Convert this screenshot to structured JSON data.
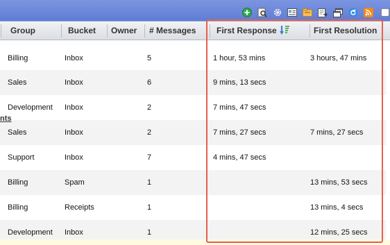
{
  "toolbar": {
    "icons": [
      "add-icon",
      "search-icon",
      "gear-icon",
      "card-icon",
      "folder-icon",
      "export-icon",
      "windows-icon",
      "refresh-icon",
      "rss-icon",
      "checkbox-icon"
    ],
    "accent": "#5f7dd6"
  },
  "header": {
    "group": "Group",
    "bucket": "Bucket",
    "owner": "Owner",
    "messages": "# Messages",
    "first_response": "First Response",
    "first_resolution": "First Resolution"
  },
  "section_label": "nts",
  "rows": [
    {
      "group": "Billing",
      "bucket": "Inbox",
      "owner": "",
      "messages": "5",
      "first_response": "1 hour, 53 mins",
      "first_resolution": "3 hours, 47 mins"
    },
    {
      "group": "Sales",
      "bucket": "Inbox",
      "owner": "",
      "messages": "6",
      "first_response": "9 mins, 13 secs",
      "first_resolution": ""
    },
    {
      "group": "Development",
      "bucket": "Inbox",
      "owner": "",
      "messages": "2",
      "first_response": "7 mins, 47 secs",
      "first_resolution": ""
    },
    {
      "group": "Sales",
      "bucket": "Inbox",
      "owner": "",
      "messages": "2",
      "first_response": "7 mins, 27 secs",
      "first_resolution": "7 mins, 27 secs"
    },
    {
      "group": "Support",
      "bucket": "Inbox",
      "owner": "",
      "messages": "7",
      "first_response": "4 mins, 47 secs",
      "first_resolution": ""
    },
    {
      "group": "Billing",
      "bucket": "Spam",
      "owner": "",
      "messages": "1",
      "first_response": "",
      "first_resolution": "13 mins, 53 secs"
    },
    {
      "group": "Billing",
      "bucket": "Receipts",
      "owner": "",
      "messages": "1",
      "first_response": "",
      "first_resolution": "13 mins, 4 secs"
    },
    {
      "group": "Development",
      "bucket": "Inbox",
      "owner": "",
      "messages": "1",
      "first_response": "",
      "first_resolution": "12 mins, 25 secs"
    }
  ],
  "highlight_color": "#e4604f"
}
